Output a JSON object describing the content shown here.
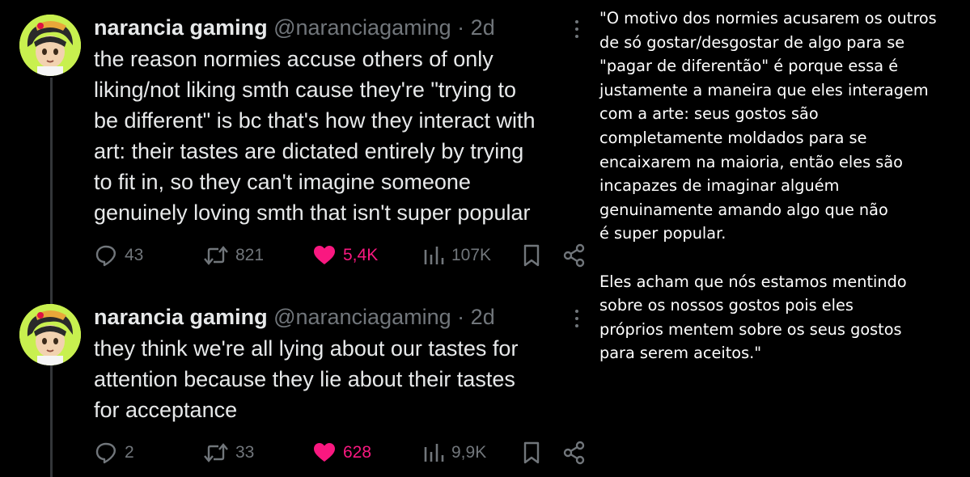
{
  "tweets": [
    {
      "name": "narancia gaming",
      "handle": "@naranciagaming",
      "separator": "·",
      "time": "2d",
      "lines": [
        "the reason normies accuse others of only",
        "liking/not liking smth cause they're \"trying to",
        "be different\" is bc that's how they interact with",
        "art: their tastes are dictated entirely by trying",
        "to fit in, so they can't imagine someone",
        "genuinely loving smth that isn't super popular"
      ],
      "replies": "43",
      "reposts": "821",
      "likes": "5,4K",
      "views": "107K"
    },
    {
      "name": "narancia gaming",
      "handle": "@naranciagaming",
      "separator": "·",
      "time": "2d",
      "lines": [
        "they think we're all lying about our tastes for",
        "attention because they lie about their tastes",
        "for acceptance"
      ],
      "replies": "2",
      "reposts": "33",
      "likes": "628",
      "views": "9,9K"
    }
  ],
  "translation": {
    "paragraph_1": "\"O motivo dos normies acusarem os outros\n de só gostar/desgostar de algo para se\n\"pagar de diferentão\" é porque essa é\njustamente a maneira que eles interagem\ncom a arte: seus gostos são\ncompletamente moldados para se\nencaixarem na maioria, então eles são\nincapazes de imaginar alguém\ngenuinamente amando algo que não\n é super popular.",
    "paragraph_2": "Eles acham que nós estamos mentindo\nsobre os nossos gostos pois eles\npróprios mentem sobre os seus gostos\npara serem aceitos.\""
  },
  "colors": {
    "background": "#000000",
    "text": "#e7e9ea",
    "muted": "#71767b",
    "like": "#f91880",
    "avatar_bg": "#c8f04f"
  },
  "icons": [
    "more-icon",
    "reply-icon",
    "repost-icon",
    "heart-icon",
    "views-icon",
    "bookmark-icon",
    "share-icon"
  ]
}
